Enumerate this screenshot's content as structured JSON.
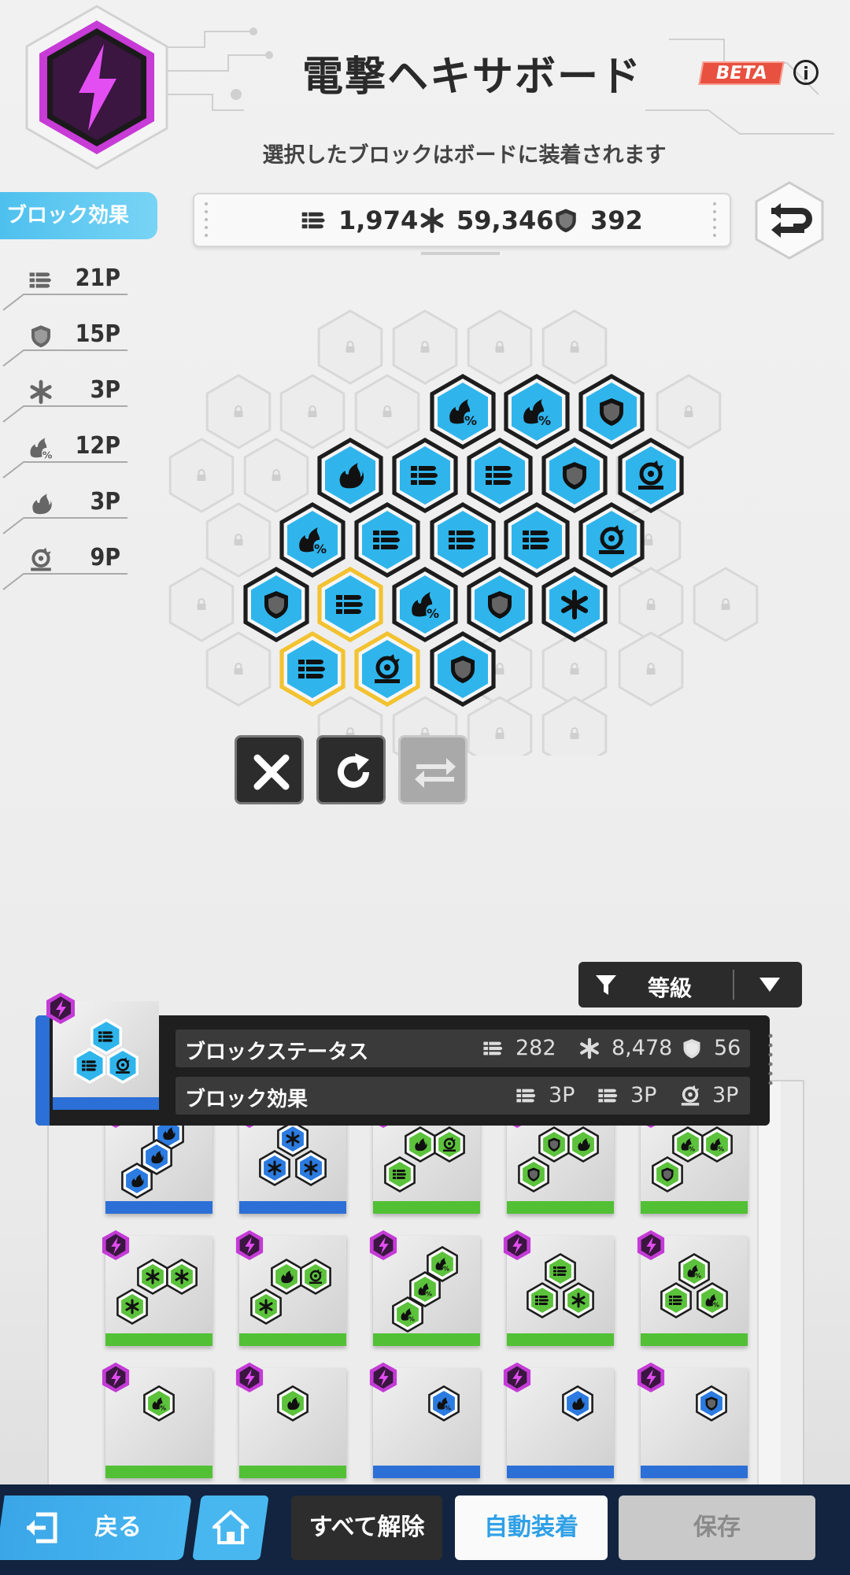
{
  "header": {
    "title": "電撃ヘキサボード",
    "beta": "BETA",
    "info": "i",
    "subtitle": "選択したブロックはボードに装着されます"
  },
  "sidebar": {
    "tab_label": "ブロック効果",
    "effects": [
      {
        "icon": "bullets-icon",
        "value": "21P"
      },
      {
        "icon": "shield-icon",
        "value": "15P"
      },
      {
        "icon": "asterisk-icon",
        "value": "3P"
      },
      {
        "icon": "fire-percent-icon",
        "value": "12P"
      },
      {
        "icon": "fire-icon",
        "value": "3P"
      },
      {
        "icon": "gauge-icon",
        "value": "9P"
      }
    ]
  },
  "stats": [
    {
      "icon": "bullets-icon",
      "value": "1,974"
    },
    {
      "icon": "asterisk-icon",
      "value": "59,346"
    },
    {
      "icon": "shield-icon",
      "value": "392"
    }
  ],
  "filter": {
    "label": "等級"
  },
  "block_status": {
    "status_label": "ブロックステータス",
    "status_values": [
      {
        "icon": "bullets-icon",
        "value": "282"
      },
      {
        "icon": "asterisk-icon",
        "value": "8,478"
      },
      {
        "icon": "shield-icon",
        "value": "56"
      }
    ],
    "effect_label": "ブロック効果",
    "effect_values": [
      {
        "icon": "bullets-icon",
        "value": "3P"
      },
      {
        "icon": "bullets-icon",
        "value": "3P"
      },
      {
        "icon": "gauge-icon",
        "value": "3P"
      }
    ]
  },
  "bottom_nav": {
    "back": "戻る",
    "clear_all": "すべて解除",
    "auto_equip": "自動装着",
    "save": "保存"
  },
  "colors": {
    "accent_blue": "#2fb5ec",
    "grade_purple": "#c43bd6",
    "highlight_gold": "#f2c230",
    "rare_blue": "#2c6fd6",
    "common_green": "#52c035"
  }
}
